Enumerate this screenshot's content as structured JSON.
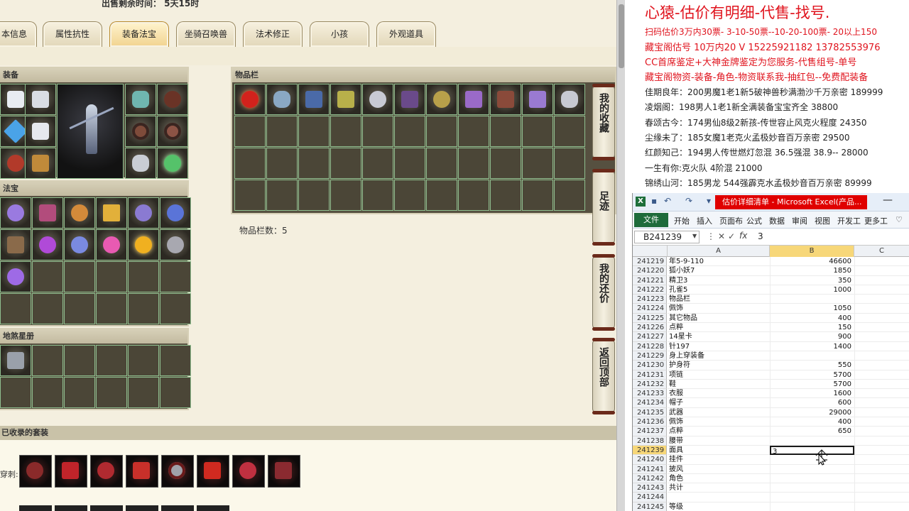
{
  "game": {
    "top_text": "出售剩余时间： 5天15时",
    "tabs": [
      {
        "label": "本信息",
        "active": false
      },
      {
        "label": "属性抗性",
        "active": false
      },
      {
        "label": "装备法宝",
        "active": true
      },
      {
        "label": "坐骑召唤兽",
        "active": false
      },
      {
        "label": "法术修正",
        "active": false
      },
      {
        "label": "小孩",
        "active": false
      },
      {
        "label": "外观道具",
        "active": false
      }
    ],
    "panels": {
      "equip": "装备",
      "fabao": "法宝",
      "star": "地煞星册",
      "inventory": "物品栏"
    },
    "inventory_count": "物品栏数：5",
    "side_buttons": [
      "我的收藏",
      "足迹",
      "我的还价",
      "返回顶部"
    ],
    "collected_title": "已收录的套装",
    "set_label": "穿刺:"
  },
  "chat": {
    "title": "心猿-估价有明细-代售-找号.",
    "lines": [
      {
        "text": "扫码估价3万内30票- 3-10-50票--10-20-100票- 20以上150",
        "style": "red"
      },
      {
        "text": "藏宝阁估号 10万内20 V 15225921182   13782553976",
        "style": "red2"
      },
      {
        "text": "CC首席鉴定+大神金牌鉴定为您服务-代售组号-单号",
        "style": "red2"
      },
      {
        "text": "藏宝阁物资-装备-角色-物资联系我-抽红包--免费配装备",
        "style": "red2"
      },
      {
        "text": "佳期良年：200男魔1老1新5破神兽秒满渤沙千万亲密 189999",
        "style": "black"
      },
      {
        "text": "凌烟阁：198男人1老1新全满装备宝宝齐全 38800",
        "style": "black"
      },
      {
        "text": "春颂古今：174男仙8级2新孩-传世容止风克火程度 24350",
        "style": "black"
      },
      {
        "text": "尘缘未了：185女魔1老克火孟极妙音百万亲密 29500",
        "style": "black"
      },
      {
        "text": "红颜知己：194男人传世燃灯忽混 36.5强混 38.9-- 28000",
        "style": "black"
      },
      {
        "text": "一生有你:克火队 4阶混 21000",
        "style": "black"
      },
      {
        "text": "锦绣山河：185男龙 544强霹克水孟极妙音百万亲密 89999",
        "style": "black"
      }
    ]
  },
  "excel": {
    "caption": "估价详细清单 - Microsoft Excel(产品...",
    "ribbon_file": "文件",
    "ribbon_tabs": [
      "开始",
      "插入",
      "页面布",
      "公式",
      "数据",
      "审阅",
      "视图",
      "开发工",
      "更多工"
    ],
    "name_box": "B241239",
    "formula_value": "3",
    "columns": [
      "A",
      "B",
      "C"
    ],
    "selected_row": "241239",
    "rows": [
      {
        "n": "241219",
        "a": "年5-9-110",
        "b": "46600"
      },
      {
        "n": "241220",
        "a": "狐小妖7",
        "b": "1850"
      },
      {
        "n": "241221",
        "a": "精卫3",
        "b": "350"
      },
      {
        "n": "241222",
        "a": "孔雀5",
        "b": "1000"
      },
      {
        "n": "241223",
        "a": "物品栏",
        "b": ""
      },
      {
        "n": "241224",
        "a": "佩饰",
        "b": "1050"
      },
      {
        "n": "241225",
        "a": "其它物品",
        "b": "400"
      },
      {
        "n": "241226",
        "a": "点粹",
        "b": "150"
      },
      {
        "n": "241227",
        "a": "14星卡",
        "b": "900"
      },
      {
        "n": "241228",
        "a": "针197",
        "b": "1400"
      },
      {
        "n": "241229",
        "a": "身上穿装备",
        "b": ""
      },
      {
        "n": "241230",
        "a": "护身符",
        "b": "550"
      },
      {
        "n": "241231",
        "a": "项链",
        "b": "5700"
      },
      {
        "n": "241232",
        "a": "鞋",
        "b": "5700"
      },
      {
        "n": "241233",
        "a": "衣服",
        "b": "1600"
      },
      {
        "n": "241234",
        "a": "帽子",
        "b": "600"
      },
      {
        "n": "241235",
        "a": "武器",
        "b": "29000"
      },
      {
        "n": "241236",
        "a": "佩饰",
        "b": "400"
      },
      {
        "n": "241237",
        "a": "点粹",
        "b": "650"
      },
      {
        "n": "241238",
        "a": "腰带",
        "b": ""
      },
      {
        "n": "241239",
        "a": "面具",
        "b": "3"
      },
      {
        "n": "241240",
        "a": "挂件",
        "b": ""
      },
      {
        "n": "241241",
        "a": "披风",
        "b": ""
      },
      {
        "n": "241242",
        "a": "角色",
        "b": ""
      },
      {
        "n": "241243",
        "a": "共计",
        "b": ""
      },
      {
        "n": "241244",
        "a": "",
        "b": ""
      },
      {
        "n": "241245",
        "a": "等级",
        "b": ""
      }
    ]
  },
  "colors": {
    "accent_red": "#e0141e",
    "excel_green": "#1e6b3a",
    "selection_yellow": "#f7d779"
  }
}
